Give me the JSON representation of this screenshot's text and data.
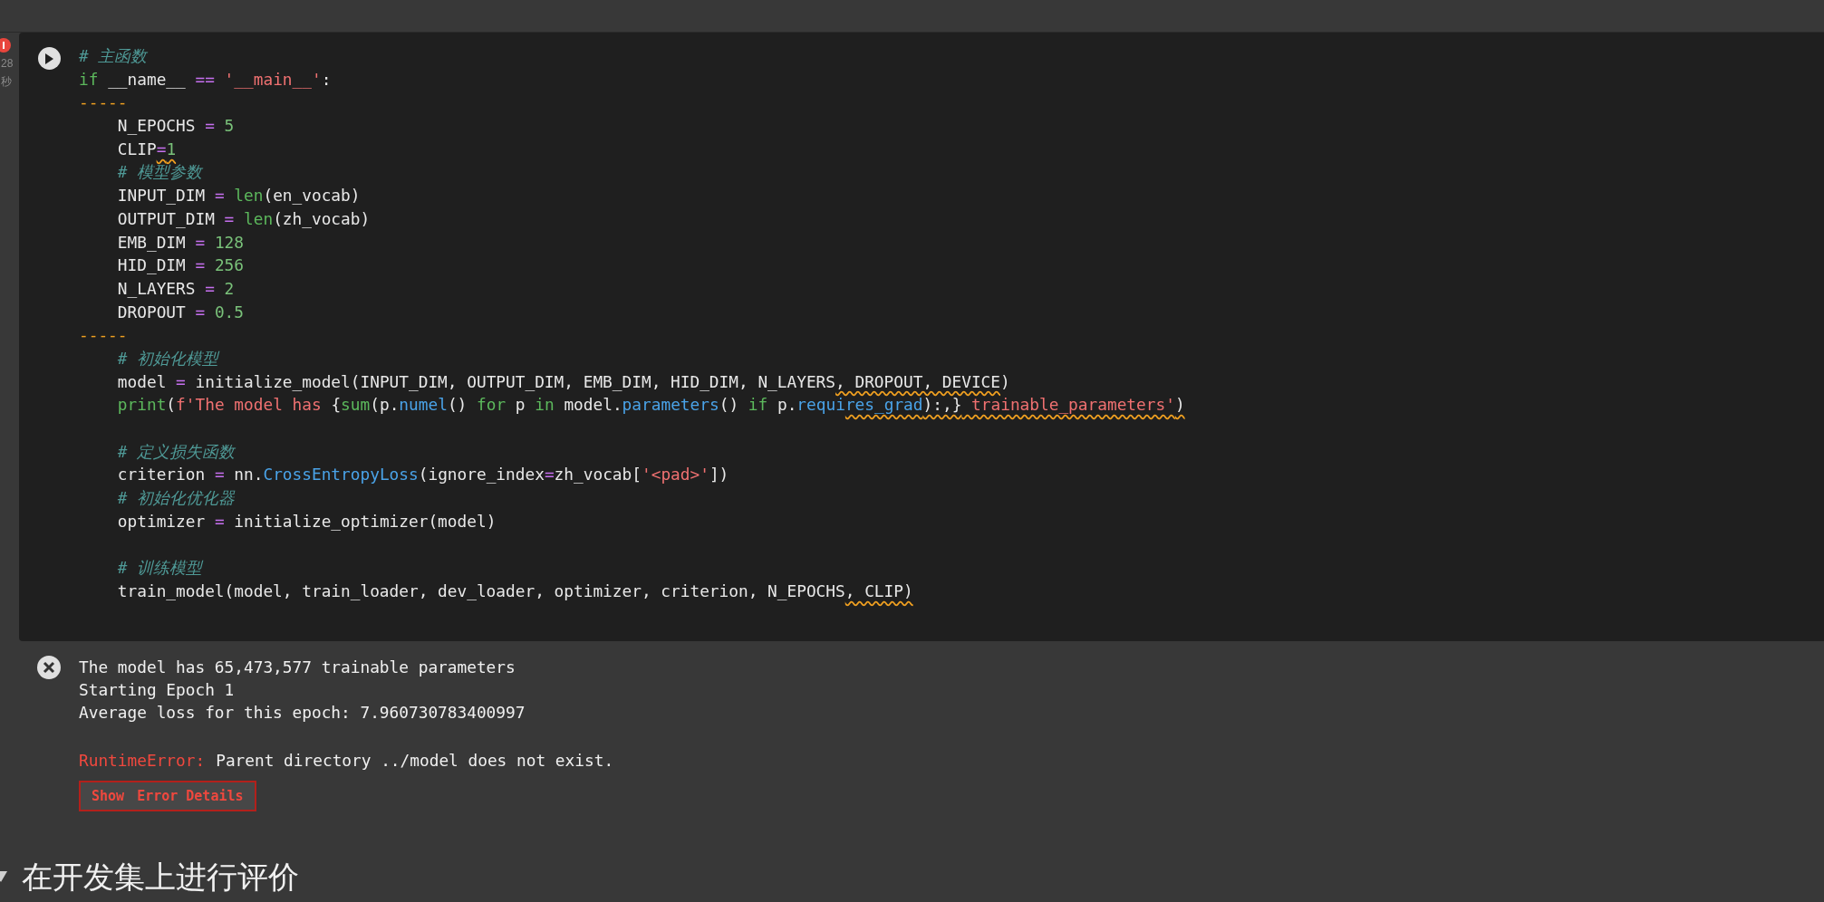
{
  "cell": {
    "error": true,
    "time": "28",
    "time_unit": "秒",
    "lines": [
      {
        "kind": "code",
        "tokens": [
          {
            "t": "# 主函数",
            "kind": "comment"
          }
        ]
      },
      {
        "kind": "code",
        "tokens": [
          {
            "t": "if",
            "kind": "keyword"
          },
          {
            "t": " __name__ ",
            "kind": "plain"
          },
          {
            "t": "==",
            "kind": "op"
          },
          {
            "t": " '__main__'",
            "kind": "string"
          },
          {
            "t": ":",
            "kind": "plain"
          }
        ]
      },
      {
        "kind": "code",
        "tokens": [
          {
            "t": "-----",
            "kind": "dash"
          }
        ]
      },
      {
        "kind": "code",
        "tokens": [
          {
            "t": "    N_EPOCHS ",
            "kind": "plain"
          },
          {
            "t": "=",
            "kind": "op"
          },
          {
            "t": " 5",
            "kind": "number"
          }
        ]
      },
      {
        "kind": "code",
        "tokens": [
          {
            "t": "    CLIP",
            "kind": "plain"
          },
          {
            "t": "=",
            "kind": "op",
            "warn": true
          },
          {
            "t": "1",
            "kind": "number",
            "warn": true
          }
        ]
      },
      {
        "kind": "code",
        "tokens": [
          {
            "t": "    # 模型参数",
            "kind": "comment"
          }
        ]
      },
      {
        "kind": "code",
        "tokens": [
          {
            "t": "    INPUT_DIM ",
            "kind": "plain"
          },
          {
            "t": "=",
            "kind": "op"
          },
          {
            "t": " len",
            "kind": "keyword"
          },
          {
            "t": "(en_vocab)",
            "kind": "plain"
          }
        ]
      },
      {
        "kind": "code",
        "tokens": [
          {
            "t": "    OUTPUT_DIM ",
            "kind": "plain"
          },
          {
            "t": "=",
            "kind": "op"
          },
          {
            "t": " len",
            "kind": "keyword"
          },
          {
            "t": "(zh_vocab)",
            "kind": "plain"
          }
        ]
      },
      {
        "kind": "code",
        "tokens": [
          {
            "t": "    EMB_DIM ",
            "kind": "plain"
          },
          {
            "t": "=",
            "kind": "op"
          },
          {
            "t": " 128",
            "kind": "number"
          }
        ]
      },
      {
        "kind": "code",
        "tokens": [
          {
            "t": "    HID_DIM ",
            "kind": "plain"
          },
          {
            "t": "=",
            "kind": "op"
          },
          {
            "t": " 256",
            "kind": "number"
          }
        ]
      },
      {
        "kind": "code",
        "tokens": [
          {
            "t": "    N_LAYERS ",
            "kind": "plain"
          },
          {
            "t": "=",
            "kind": "op"
          },
          {
            "t": " 2",
            "kind": "number"
          }
        ]
      },
      {
        "kind": "code",
        "tokens": [
          {
            "t": "    DROPOUT ",
            "kind": "plain"
          },
          {
            "t": "=",
            "kind": "op"
          },
          {
            "t": " 0.5",
            "kind": "number"
          }
        ]
      },
      {
        "kind": "code",
        "tokens": [
          {
            "t": "-----",
            "kind": "dash"
          }
        ]
      },
      {
        "kind": "code",
        "tokens": [
          {
            "t": "    # 初始化模型",
            "kind": "comment"
          }
        ]
      },
      {
        "kind": "code",
        "tokens": [
          {
            "t": "    model ",
            "kind": "plain"
          },
          {
            "t": "=",
            "kind": "op"
          },
          {
            "t": " initialize_model(INPUT_DIM, OUTPUT_DIM, EMB_DIM, HID_DIM, N_LAYERS",
            "kind": "plain"
          },
          {
            "t": ", DROPOUT, DEVICE",
            "kind": "plain",
            "warn": true
          },
          {
            "t": ")",
            "kind": "plain"
          }
        ]
      },
      {
        "kind": "code",
        "tokens": [
          {
            "t": "    print",
            "kind": "keyword"
          },
          {
            "t": "(",
            "kind": "plain"
          },
          {
            "t": "f'The model has ",
            "kind": "string"
          },
          {
            "t": "{",
            "kind": "plain"
          },
          {
            "t": "sum",
            "kind": "keyword"
          },
          {
            "t": "(p.",
            "kind": "plain"
          },
          {
            "t": "numel",
            "kind": "func"
          },
          {
            "t": "() ",
            "kind": "plain"
          },
          {
            "t": "for",
            "kind": "keyword"
          },
          {
            "t": " p ",
            "kind": "plain"
          },
          {
            "t": "in",
            "kind": "keyword"
          },
          {
            "t": " model.",
            "kind": "plain"
          },
          {
            "t": "parameters",
            "kind": "func"
          },
          {
            "t": "() ",
            "kind": "plain"
          },
          {
            "t": "if",
            "kind": "keyword"
          },
          {
            "t": " p.",
            "kind": "plain"
          },
          {
            "t": "requi",
            "kind": "func"
          },
          {
            "t": "res_grad",
            "kind": "func",
            "warn": true
          },
          {
            "t": "):,}",
            "kind": "plain",
            "warn": true
          },
          {
            "t": " trainable_parameters'",
            "kind": "string",
            "warn": true
          },
          {
            "t": ")",
            "kind": "plain",
            "warn": true
          }
        ]
      },
      {
        "kind": "blank"
      },
      {
        "kind": "code",
        "tokens": [
          {
            "t": "    # 定义损失函数",
            "kind": "comment"
          }
        ]
      },
      {
        "kind": "code",
        "tokens": [
          {
            "t": "    criterion ",
            "kind": "plain"
          },
          {
            "t": "=",
            "kind": "op"
          },
          {
            "t": " nn.",
            "kind": "plain"
          },
          {
            "t": "CrossEntropyLoss",
            "kind": "func"
          },
          {
            "t": "(ignore_index",
            "kind": "plain"
          },
          {
            "t": "=",
            "kind": "op"
          },
          {
            "t": "zh_vocab[",
            "kind": "plain"
          },
          {
            "t": "'<pad>'",
            "kind": "string"
          },
          {
            "t": "])",
            "kind": "plain"
          }
        ]
      },
      {
        "kind": "code",
        "tokens": [
          {
            "t": "    # 初始化优化器",
            "kind": "comment"
          }
        ]
      },
      {
        "kind": "code",
        "tokens": [
          {
            "t": "    optimizer ",
            "kind": "plain"
          },
          {
            "t": "=",
            "kind": "op"
          },
          {
            "t": " initialize_optimizer(model)",
            "kind": "plain"
          }
        ]
      },
      {
        "kind": "blank"
      },
      {
        "kind": "code",
        "tokens": [
          {
            "t": "    # 训练模型",
            "kind": "comment"
          }
        ]
      },
      {
        "kind": "code",
        "tokens": [
          {
            "t": "    train_model(model, train_loader, dev_loader, optimizer, criterion, N_EPOCHS",
            "kind": "plain"
          },
          {
            "t": ", CLIP)",
            "kind": "plain",
            "warn": true
          }
        ]
      }
    ]
  },
  "output": {
    "lines": [
      "The model has 65,473,577 trainable parameters",
      "Starting Epoch 1",
      "Average loss for this epoch: 7.960730783400997"
    ],
    "error_name": "RuntimeError:",
    "error_message": "Parent directory ../model does not exist.",
    "button": {
      "label_1": "Show",
      "label_2": "Error Details"
    }
  },
  "next_heading": "在开发集上进行评价"
}
